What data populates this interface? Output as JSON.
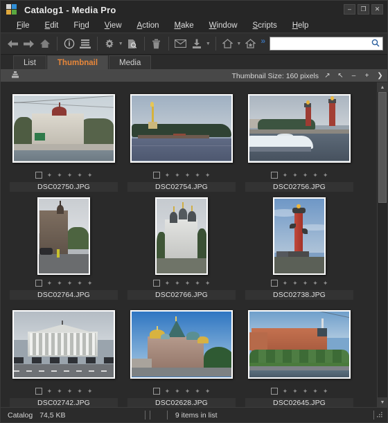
{
  "window": {
    "title": "Catalog1 - Media Pro",
    "app_icon": "media-pro-icon",
    "minimize": "–",
    "maximize": "❐",
    "close": "✕"
  },
  "menu": [
    {
      "label": "File"
    },
    {
      "label": "Edit"
    },
    {
      "label": "Find"
    },
    {
      "label": "View"
    },
    {
      "label": "Action"
    },
    {
      "label": "Make"
    },
    {
      "label": "Window"
    },
    {
      "label": "Scripts"
    },
    {
      "label": "Help"
    }
  ],
  "toolbar": {
    "buttons": [
      {
        "name": "back-arrow-icon",
        "glyph": "◀"
      },
      {
        "name": "forward-arrow-icon",
        "glyph": "▶"
      },
      {
        "name": "home-icon",
        "glyph": "⌂"
      },
      {
        "name": "info-icon",
        "glyph": "i"
      },
      {
        "name": "list-icon",
        "glyph": "≣"
      },
      {
        "name": "gear-icon",
        "glyph": "✸"
      },
      {
        "name": "preview-icon",
        "glyph": "▤"
      },
      {
        "name": "trash-icon",
        "glyph": "▯"
      },
      {
        "name": "envelope-icon",
        "glyph": "✉"
      },
      {
        "name": "import-icon",
        "glyph": "⤓"
      },
      {
        "name": "export-icon",
        "glyph": "⌂"
      },
      {
        "name": "favorite-icon",
        "glyph": "⌂"
      }
    ],
    "overflow": "»",
    "search_value": "",
    "search_placeholder": "",
    "search_icon": "search-icon"
  },
  "tabs": [
    {
      "label": "List",
      "active": false
    },
    {
      "label": "Thumbnail",
      "active": true
    },
    {
      "label": "Media",
      "active": false
    }
  ],
  "sizebar": {
    "sort_icon": "sort-icon",
    "label": "Thumbnail Size: 160 pixels",
    "controls": [
      {
        "name": "expand-icon",
        "glyph": "↗"
      },
      {
        "name": "collapse-icon",
        "glyph": "↖"
      },
      {
        "name": "decrease-size-icon",
        "glyph": "–"
      },
      {
        "name": "increase-size-icon",
        "glyph": "+"
      },
      {
        "name": "next-icon",
        "glyph": "❯"
      }
    ]
  },
  "scrollbar": {
    "up_arrow": "▲",
    "down_arrow": "▼"
  },
  "thumbnails": [
    {
      "filename": "DSC02750.JPG",
      "orientation": "landscape",
      "art": "p1",
      "checked": false,
      "rating": 0
    },
    {
      "filename": "DSC02754.JPG",
      "orientation": "landscape",
      "art": "p2",
      "checked": false,
      "rating": 0
    },
    {
      "filename": "DSC02756.JPG",
      "orientation": "landscape",
      "art": "p3",
      "checked": false,
      "rating": 0
    },
    {
      "filename": "DSC02764.JPG",
      "orientation": "portrait",
      "art": "p4",
      "checked": false,
      "rating": 0
    },
    {
      "filename": "DSC02766.JPG",
      "orientation": "portrait",
      "art": "p5",
      "checked": false,
      "rating": 0
    },
    {
      "filename": "DSC02738.JPG",
      "orientation": "portrait",
      "art": "p6",
      "checked": false,
      "rating": 0
    },
    {
      "filename": "DSC02742.JPG",
      "orientation": "landscape",
      "art": "p7",
      "checked": false,
      "rating": 0
    },
    {
      "filename": "DSC02628.JPG",
      "orientation": "landscape",
      "art": "p8",
      "checked": false,
      "rating": 0
    },
    {
      "filename": "DSC02645.JPG",
      "orientation": "landscape",
      "art": "p9",
      "checked": false,
      "rating": 0
    }
  ],
  "rating_star": "✦",
  "statusbar": {
    "catalog_label": "Catalog",
    "catalog_size": "74,5 KB",
    "items_text": "9 items in list",
    "grip": "◢"
  },
  "colors": {
    "accent": "#e8873a",
    "window_bg": "#2b2b2b",
    "titlebar_bg": "#262626",
    "toolbar_bg": "#2e2e2e",
    "sizebar_bg": "#484848",
    "text": "#e0e0e0"
  }
}
